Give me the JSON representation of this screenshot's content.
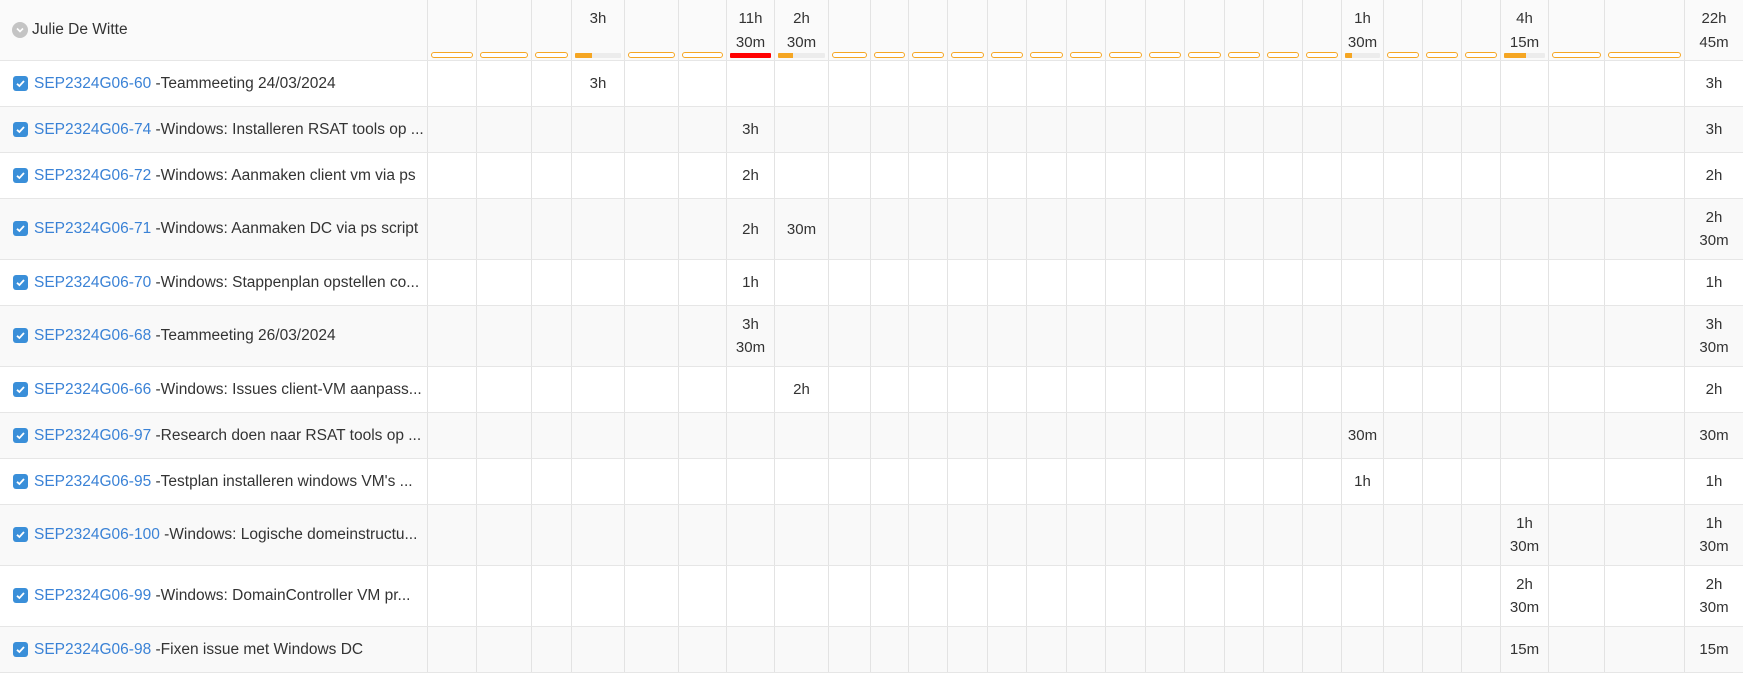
{
  "header": {
    "user_name": "Julie De Witte",
    "collapse_icon": "chevron-down-icon",
    "day_totals": [
      {
        "label": "",
        "load": 0,
        "status": "empty"
      },
      {
        "label": "",
        "load": 0,
        "status": "empty"
      },
      {
        "label": "",
        "load": 0,
        "status": "empty"
      },
      {
        "label": "3h",
        "load": 0.38,
        "status": "partial"
      },
      {
        "label": "",
        "load": 0,
        "status": "empty"
      },
      {
        "label": "",
        "load": 0,
        "status": "empty"
      },
      {
        "label": "11h\n30m",
        "load": 1.0,
        "status": "over"
      },
      {
        "label": "2h\n30m",
        "load": 0.31,
        "status": "partial"
      },
      {
        "label": "",
        "load": 0,
        "status": "empty"
      },
      {
        "label": "",
        "load": 0,
        "status": "empty"
      },
      {
        "label": "",
        "load": 0,
        "status": "empty"
      },
      {
        "label": "",
        "load": 0,
        "status": "empty"
      },
      {
        "label": "",
        "load": 0,
        "status": "empty"
      },
      {
        "label": "",
        "load": 0,
        "status": "empty"
      },
      {
        "label": "",
        "load": 0,
        "status": "empty"
      },
      {
        "label": "",
        "load": 0,
        "status": "empty"
      },
      {
        "label": "",
        "load": 0,
        "status": "empty"
      },
      {
        "label": "",
        "load": 0,
        "status": "empty"
      },
      {
        "label": "",
        "load": 0,
        "status": "empty"
      },
      {
        "label": "",
        "load": 0,
        "status": "empty"
      },
      {
        "label": "",
        "load": 0,
        "status": "empty"
      },
      {
        "label": "1h\n30m",
        "load": 0.19,
        "status": "partial"
      },
      {
        "label": "",
        "load": 0,
        "status": "empty"
      },
      {
        "label": "",
        "load": 0,
        "status": "empty"
      },
      {
        "label": "",
        "load": 0,
        "status": "empty"
      },
      {
        "label": "4h\n15m",
        "load": 0.53,
        "status": "partial"
      },
      {
        "label": "",
        "load": 0,
        "status": "empty"
      },
      {
        "label": "",
        "load": 0,
        "status": "empty"
      }
    ],
    "total": "22h\n45m"
  },
  "tasks": [
    {
      "key": "SEP2324G06-60",
      "summary": "Teammeeting 24/03/2024",
      "cells": {
        "3": "3h"
      },
      "total": "3h"
    },
    {
      "key": "SEP2324G06-74",
      "summary": "Windows: Installeren RSAT tools op ...",
      "cells": {
        "6": "3h"
      },
      "total": "3h"
    },
    {
      "key": "SEP2324G06-72",
      "summary": "Windows: Aanmaken client vm via ps",
      "cells": {
        "6": "2h"
      },
      "total": "2h"
    },
    {
      "key": "SEP2324G06-71",
      "summary": "Windows: Aanmaken DC via ps script",
      "cells": {
        "6": "2h",
        "7": "30m"
      },
      "total": "2h\n30m"
    },
    {
      "key": "SEP2324G06-70",
      "summary": "Windows: Stappenplan opstellen co...",
      "cells": {
        "6": "1h"
      },
      "total": "1h"
    },
    {
      "key": "SEP2324G06-68",
      "summary": "Teammeeting 26/03/2024",
      "cells": {
        "6": "3h\n30m"
      },
      "total": "3h\n30m"
    },
    {
      "key": "SEP2324G06-66",
      "summary": "Windows: Issues client-VM aanpass...",
      "cells": {
        "7": "2h"
      },
      "total": "2h"
    },
    {
      "key": "SEP2324G06-97",
      "summary": "Research doen naar RSAT tools op ...",
      "cells": {
        "21": "30m"
      },
      "total": "30m"
    },
    {
      "key": "SEP2324G06-95",
      "summary": "Testplan installeren windows VM's ...",
      "cells": {
        "21": "1h"
      },
      "total": "1h"
    },
    {
      "key": "SEP2324G06-100",
      "summary": "Windows: Logische domeinstructu...",
      "cells": {
        "25": "1h\n30m"
      },
      "total": "1h\n30m"
    },
    {
      "key": "SEP2324G06-99",
      "summary": "Windows: DomainController VM pr...",
      "cells": {
        "25": "2h\n30m"
      },
      "total": "2h\n30m"
    },
    {
      "key": "SEP2324G06-98",
      "summary": "Fixen issue met Windows DC",
      "cells": {
        "25": "15m"
      },
      "total": "15m"
    }
  ],
  "colors": {
    "issue_link": "#3a82d6",
    "checkbox": "#3a8fd9",
    "capacity_bar": "#f5a623",
    "over_capacity": "#ff0000"
  }
}
